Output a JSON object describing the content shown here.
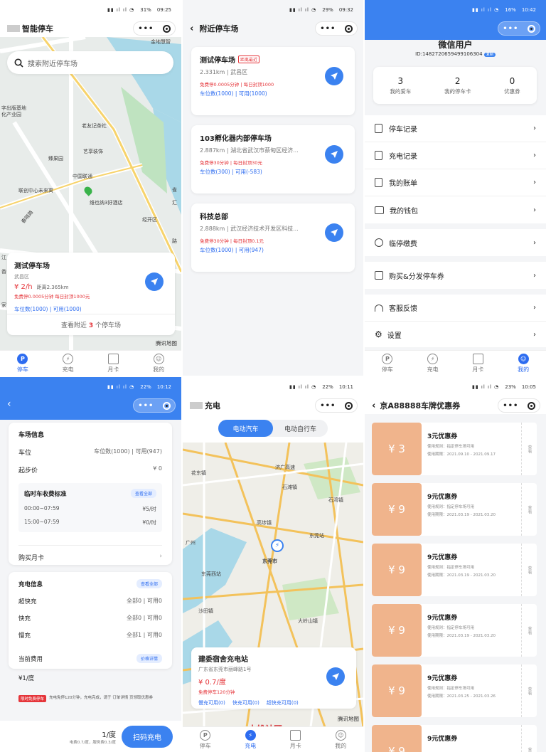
{
  "p1": {
    "time": "09:25",
    "battery": "31%",
    "title": "智能停车",
    "search_placeholder": "搜索附近停车场",
    "map_labels": [
      "金地慧智",
      "字出版基地",
      "化产业园",
      "老友记茶社",
      "艺享装饰",
      "臻果园",
      "中国联通",
      "联创中心未来寓",
      "维也纳3好酒店",
      "春晓路",
      "经开区",
      "路",
      "雀",
      "汇",
      "江",
      "香",
      "家"
    ],
    "card": {
      "name": "测试停车场",
      "district": "武昌区",
      "price": "¥ 2/h",
      "distance": "距离2.365km",
      "rule": "免费停0.0005分钟  每日封顶1000元",
      "spots": "车位数(1000) | 可用(1000)",
      "nearby_pre": "查看附近",
      "nearby_count": "3",
      "nearby_post": "个停车场"
    },
    "logo": "腾讯地图",
    "tabs": [
      "停车",
      "充电",
      "月卡",
      "我的"
    ]
  },
  "p2": {
    "time": "09:32",
    "battery": "29%",
    "title": "附近停车场",
    "lots": [
      {
        "name": "测试停车场",
        "tag": "距离最近",
        "info": "2.331km | 武昌区",
        "rule": "免费停0.0005分钟 | 每日封顶1000",
        "spots": "车位数(1000) | 可用(1000)"
      },
      {
        "name": "103孵化器内部停车场",
        "tag": "",
        "info": "2.887km | 湖北省武汉市蔡甸区经济...",
        "rule": "免费停30分钟 | 每日封顶30元",
        "spots": "车位数(300) | 可用(-583)"
      },
      {
        "name": "科技总部",
        "tag": "",
        "info": "2.888km | 武汉经济技术开发区科技...",
        "rule": "免费停30分钟 | 每日封顶0.1元",
        "spots": "车位数(1000) | 可用(947)"
      }
    ]
  },
  "p3": {
    "time": "10:42",
    "battery": "16%",
    "user": "微信用户",
    "id": "ID:1482720659499106304",
    "id_tag": "复制",
    "stats": [
      {
        "value": "3",
        "label": "我的爱车"
      },
      {
        "value": "2",
        "label": "我的停车卡"
      },
      {
        "value": "0",
        "label": "优惠券"
      }
    ],
    "menu": [
      "停车记录",
      "充电记录",
      "我的账单",
      "我的钱包",
      "临停缴费",
      "购买&分发停车券",
      "客服反馈",
      "设置"
    ],
    "tabs": [
      "停车",
      "充电",
      "月卡",
      "我的"
    ]
  },
  "p4": {
    "time": "10:12",
    "battery": "22%",
    "lot_title": "车场信息",
    "spot_label": "车位",
    "spot_value": "车位数(1000) | 可用(947)",
    "start_label": "起步价",
    "start_value": "¥ 0",
    "temp_title": "临时车收费标准",
    "view_all": "查看全部",
    "periods": [
      {
        "time": "00:00~07:59",
        "price": "¥5/时"
      },
      {
        "time": "15:00~07:59",
        "price": "¥0/时"
      }
    ],
    "monthly": "购买月卡",
    "charge_title": "充电信息",
    "charge_view": "查看全部",
    "charges": [
      {
        "label": "超快充",
        "value": "全部0 | 可用0"
      },
      {
        "label": "快充",
        "value": "全部0 | 可用0"
      },
      {
        "label": "慢充",
        "value": "全部1 | 可用0"
      }
    ],
    "fee_label": "当前费用",
    "fee_value": "¥1/度",
    "price_detail": "价格详情",
    "badge": "限时免费停车",
    "notice": "充电免停120分钟，充电完成，请于 订单详情 页领取优惠券",
    "bottom_price": "1/度",
    "bottom_detail": "电费0.7/度，服务费0.3/度",
    "scan_btn": "扫码充电"
  },
  "p5": {
    "time": "10:11",
    "battery": "22%",
    "title": "充电",
    "seg": [
      "电动汽车",
      "电动自行车"
    ],
    "map_labels": [
      "花东镇",
      "济广高速",
      "石滩镇",
      "石湾镇",
      "高埗镇",
      "东莞站",
      "东莞市",
      "东莞西站",
      "沙田镇",
      "大岭山镇",
      "广州"
    ],
    "station": {
      "name": "建委宿舍充电站",
      "addr": "广东省东莞市丽峰路1号",
      "price": "¥ 0.7/度",
      "free": "免费停车120分钟",
      "slots": [
        "慢充可用(0)",
        "快充可用(0)",
        "超快充可用(0)"
      ]
    },
    "logo": "腾讯地图",
    "watermark": "大雄社区",
    "tabs": [
      "停车",
      "充电",
      "月卡",
      "我的"
    ]
  },
  "p6": {
    "time": "10:05",
    "battery": "23%",
    "title": "京A88888车牌优惠券",
    "view": "查看",
    "coupons": [
      {
        "amount": "¥ 3",
        "name": "3元优惠券",
        "rule": "使用规则：指定停车场可用",
        "date": "使用期限：2021.09.10 - 2021.09.17"
      },
      {
        "amount": "¥ 9",
        "name": "9元优惠券",
        "rule": "使用规则：指定停车场可用",
        "date": "使用期限：2021.03.19 - 2021.03.20"
      },
      {
        "amount": "¥ 9",
        "name": "9元优惠券",
        "rule": "使用规则：指定停车场可用",
        "date": "使用期限：2021.03.19 - 2021.03.20"
      },
      {
        "amount": "¥ 9",
        "name": "9元优惠券",
        "rule": "使用规则：指定停车场可用",
        "date": "使用期限：2021.03.19 - 2021.03.20"
      },
      {
        "amount": "¥ 9",
        "name": "9元优惠券",
        "rule": "使用规则：指定停车场可用",
        "date": "使用期限：2021.03.25 - 2021.03.26"
      },
      {
        "amount": "¥ 9",
        "name": "9元优惠券",
        "rule": "",
        "date": ""
      }
    ]
  },
  "colors": {
    "accent": "#2d6cf0",
    "red": "#e5353a",
    "coupon": "#f0b48c"
  }
}
